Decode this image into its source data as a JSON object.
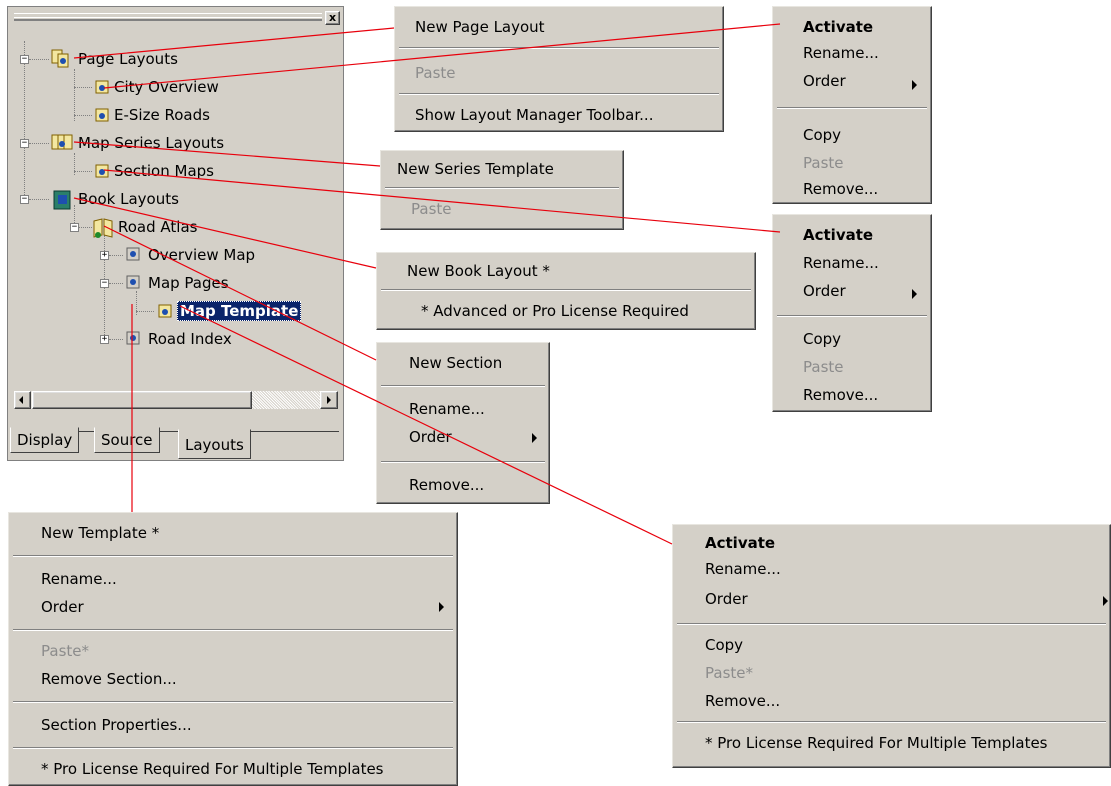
{
  "panel": {
    "close_glyph": "x",
    "tree": {
      "page_layouts": "Page Layouts",
      "city_overview": "City Overview",
      "e_size_roads": "E-Size Roads",
      "map_series_layouts": "Map Series Layouts",
      "section_maps": "Section Maps",
      "book_layouts": "Book Layouts",
      "road_atlas": "Road Atlas",
      "overview_map": "Overview Map",
      "map_pages": "Map Pages",
      "map_template": "Map Template",
      "road_index": "Road Index"
    },
    "tabs": {
      "display": "Display",
      "source": "Source",
      "layouts": "Layouts"
    }
  },
  "menus": {
    "page_layouts_menu": {
      "new_page_layout": "New Page Layout",
      "paste": "Paste",
      "show_toolbar": "Show Layout Manager Toolbar..."
    },
    "page_item_menu": {
      "activate": "Activate",
      "rename": "Rename...",
      "order": "Order",
      "copy": "Copy",
      "paste": "Paste",
      "remove": "Remove..."
    },
    "series_menu": {
      "new_series_template": "New Series Template",
      "paste": "Paste"
    },
    "series_item_menu": {
      "activate": "Activate",
      "rename": "Rename...",
      "order": "Order",
      "copy": "Copy",
      "paste": "Paste",
      "remove": "Remove..."
    },
    "book_menu": {
      "new_book_layout": "New Book Layout *",
      "note": "* Advanced or Pro License Required"
    },
    "book_item_menu": {
      "new_section": "New Section",
      "rename": "Rename...",
      "order": "Order",
      "remove": "Remove..."
    },
    "section_menu": {
      "new_template": "New Template *",
      "rename": "Rename...",
      "order": "Order",
      "paste": "Paste*",
      "remove_section": "Remove Section...",
      "section_properties": "Section Properties...",
      "note": "* Pro License Required For Multiple Templates"
    },
    "template_menu": {
      "activate": "Activate",
      "rename": "Rename...",
      "order": "Order",
      "copy": "Copy",
      "paste": "Paste*",
      "remove": "Remove...",
      "note": "* Pro License Required For Multiple Templates"
    }
  },
  "colors": {
    "connector": "#e8000c",
    "menu_bg": "#d4d0c8",
    "selection": "#0a246a"
  }
}
